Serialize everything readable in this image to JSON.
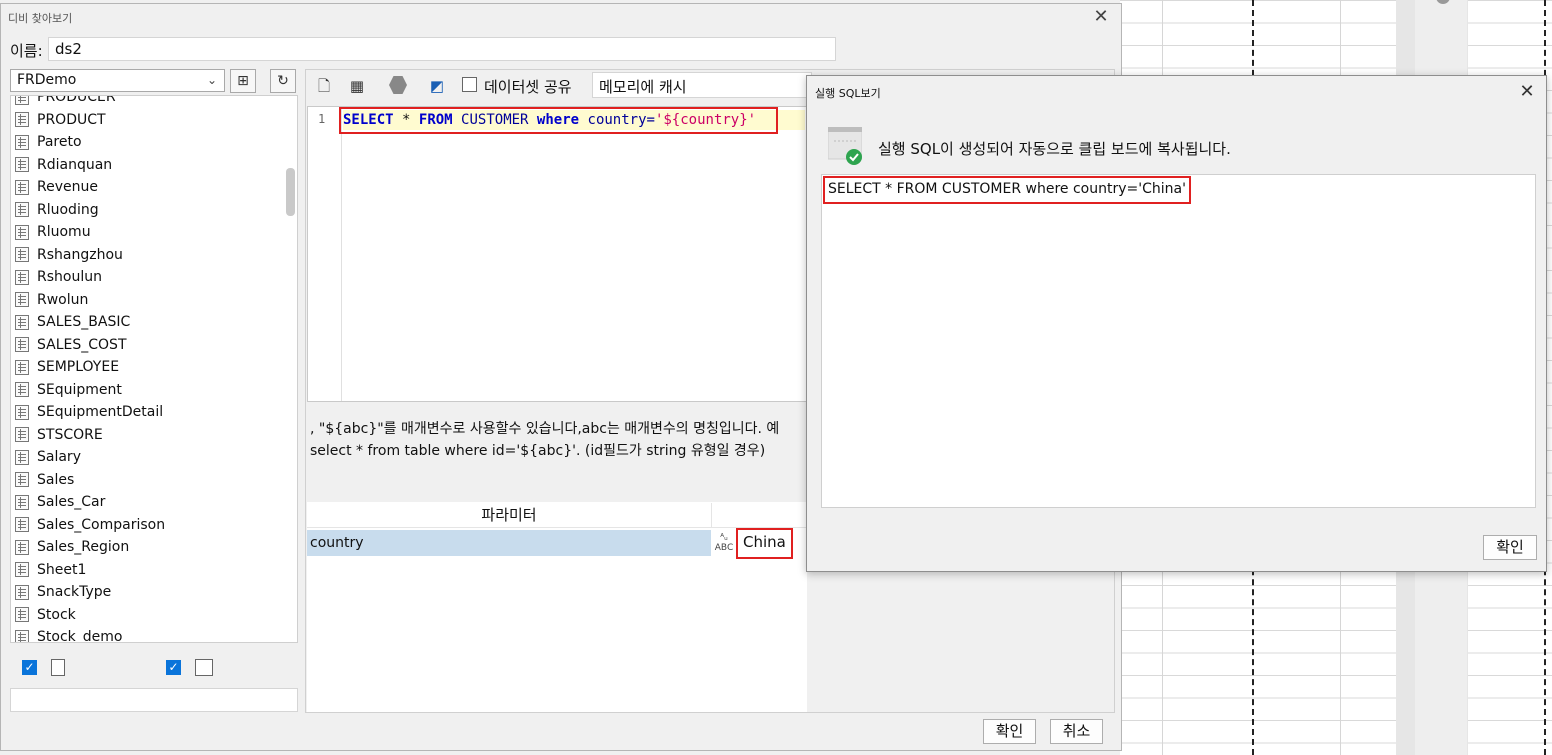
{
  "main_dialog": {
    "title": "디비 찾아보기",
    "close_glyph": "✕",
    "name_label": "이름:",
    "name_value": "ds2",
    "db_select": "FRDemo",
    "tables": [
      "PRODUCER",
      "PRODUCT",
      "Pareto",
      "Rdianquan",
      "Revenue",
      "Rluoding",
      "Rluomu",
      "Rshangzhou",
      "Rshoulun",
      "Rwolun",
      "SALES_BASIC",
      "SALES_COST",
      "SEMPLOYEE",
      "SEquipment",
      "SEquipmentDetail",
      "STSCORE",
      "Salary",
      "Sales",
      "Sales_Car",
      "Sales_Comparison",
      "Sales_Region",
      "Sheet1",
      "SnackType",
      "Stock",
      "Stock_demo"
    ],
    "share_label": "데이터셋 공유",
    "cache_select": "메모리에 캐시",
    "sql": {
      "line_no": "1",
      "select": "SELECT",
      "star": "*",
      "from": "FROM",
      "table": "CUSTOMER",
      "where": "where",
      "column": "country=",
      "value": "'${country}'"
    },
    "hint_line1": ", \"${abc}\"를 매개변수로 사용할수 있습니다,abc는 매개변수의 명칭입니다. 예",
    "hint_line2": "select * from table where id='${abc}'. (id필드가 string 유형일 경우)",
    "param_header": "파라미터",
    "param_name": "country",
    "param_value": "China",
    "ok_label": "확인",
    "cancel_label": "취소"
  },
  "popup": {
    "title": "실행 SQL보기",
    "close_glyph": "✕",
    "message": "실행 SQL이 생성되어 자동으로 클립 보드에 복사됩니다.",
    "sql_text": "SELECT * FROM CUSTOMER where country='China'",
    "ok_label": "확인"
  },
  "colors": {
    "highlight_red": "#e02020",
    "check_blue": "#0a74da",
    "param_row_blue": "#c8dced",
    "sql_keyword": "#0000cc",
    "sql_string": "#cc0066"
  }
}
